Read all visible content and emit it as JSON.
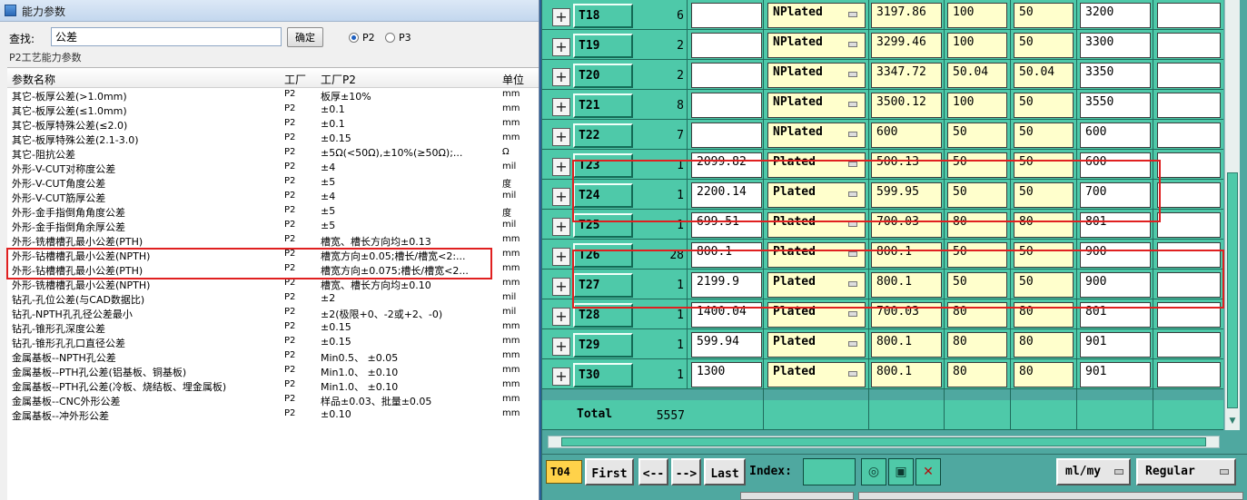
{
  "left_window": {
    "title": "能力参数",
    "search": {
      "label": "查找:",
      "value": "公差"
    },
    "confirm_label": "确定",
    "radios": [
      {
        "label": "P2",
        "checked": true
      },
      {
        "label": "P3",
        "checked": false
      }
    ],
    "group_label": "P2工艺能力参数",
    "columns": [
      "参数名称",
      "工厂",
      "工厂P2",
      "单位"
    ],
    "rows": [
      [
        "其它-板厚公差(>1.0mm)",
        "P2",
        "板厚±10%",
        "mm"
      ],
      [
        "其它-板厚公差(≤1.0mm)",
        "P2",
        "±0.1",
        "mm"
      ],
      [
        "其它-板厚特殊公差(≤2.0)",
        "P2",
        "±0.1",
        "mm"
      ],
      [
        "其它-板厚特殊公差(2.1-3.0)",
        "P2",
        "±0.15",
        "mm"
      ],
      [
        "其它-阻抗公差",
        "P2",
        "±5Ω(<50Ω),±10%(≥50Ω);...",
        "Ω"
      ],
      [
        "外形-V-CUT对称度公差",
        "P2",
        "±4",
        "mil"
      ],
      [
        "外形-V-CUT角度公差",
        "P2",
        "±5",
        "度"
      ],
      [
        "外形-V-CUT筋厚公差",
        "P2",
        "±4",
        "mil"
      ],
      [
        "外形-金手指倒角角度公差",
        "P2",
        "±5",
        "度"
      ],
      [
        "外形-金手指倒角余厚公差",
        "P2",
        "±5",
        "mil"
      ],
      [
        "外形-铣槽槽孔最小公差(PTH)",
        "P2",
        "槽宽、槽长方向均±0.13",
        "mm"
      ],
      [
        "外形-钻槽槽孔最小公差(NPTH)",
        "P2",
        "槽宽方向±0.05;槽长/槽宽<2:...",
        "mm"
      ],
      [
        "外形-钻槽槽孔最小公差(PTH)",
        "P2",
        "槽宽方向±0.075;槽长/槽宽<2...",
        "mm"
      ],
      [
        "外形-铣槽槽孔最小公差(NPTH)",
        "P2",
        "槽宽、槽长方向均±0.10",
        "mm"
      ],
      [
        "钻孔-孔位公差(与CAD数据比)",
        "P2",
        "±2",
        "mil"
      ],
      [
        "钻孔-NPTH孔孔径公差最小",
        "P2",
        "±2(极限+0、-2或+2、-0)",
        "mil"
      ],
      [
        "钻孔-锥形孔深度公差",
        "P2",
        "±0.15",
        "mm"
      ],
      [
        "钻孔-锥形孔孔口直径公差",
        "P2",
        "±0.15",
        "mm"
      ],
      [
        "金属基板--NPTH孔公差",
        "P2",
        "Min0.5、 ±0.05",
        "mm"
      ],
      [
        "金属基板--PTH孔公差(铝基板、铜基板)",
        "P2",
        "Min1.0、 ±0.10",
        "mm"
      ],
      [
        "金属基板--PTH孔公差(冷板、烧结板、埋金属板)",
        "P2",
        "Min1.0、 ±0.10",
        "mm"
      ],
      [
        "金属基板--CNC外形公差",
        "P2",
        "样品±0.03、批量±0.05",
        "mm"
      ],
      [
        "金属基板--冲外形公差",
        "P2",
        "±0.10",
        "mm"
      ]
    ]
  },
  "right_window": {
    "rows": [
      {
        "tool": "T18",
        "qty": "6",
        "c1": "",
        "type": "NPlated",
        "c3": "3197.86",
        "c4": "100",
        "c5": "50",
        "c6": "3200"
      },
      {
        "tool": "T19",
        "qty": "2",
        "c1": "",
        "type": "NPlated",
        "c3": "3299.46",
        "c4": "100",
        "c5": "50",
        "c6": "3300"
      },
      {
        "tool": "T20",
        "qty": "2",
        "c1": "",
        "type": "NPlated",
        "c3": "3347.72",
        "c4": "50.04",
        "c5": "50.04",
        "c6": "3350"
      },
      {
        "tool": "T21",
        "qty": "8",
        "c1": "",
        "type": "NPlated",
        "c3": "3500.12",
        "c4": "100",
        "c5": "50",
        "c6": "3550"
      },
      {
        "tool": "T22",
        "qty": "7",
        "c1": "",
        "type": "NPlated",
        "c3": "600",
        "c4": "50",
        "c5": "50",
        "c6": "600"
      },
      {
        "tool": "T23",
        "qty": "1",
        "c1": "2099.82",
        "type": "Plated",
        "c3": "500.13",
        "c4": "50",
        "c5": "50",
        "c6": "600"
      },
      {
        "tool": "T24",
        "qty": "1",
        "c1": "2200.14",
        "type": "Plated",
        "c3": "599.95",
        "c4": "50",
        "c5": "50",
        "c6": "700"
      },
      {
        "tool": "T25",
        "qty": "1",
        "c1": "699.51",
        "type": "Plated",
        "c3": "700.03",
        "c4": "80",
        "c5": "80",
        "c6": "801"
      },
      {
        "tool": "T26",
        "qty": "28",
        "c1": "800.1",
        "type": "Plated",
        "c3": "800.1",
        "c4": "50",
        "c5": "50",
        "c6": "900"
      },
      {
        "tool": "T27",
        "qty": "1",
        "c1": "2199.9",
        "type": "Plated",
        "c3": "800.1",
        "c4": "50",
        "c5": "50",
        "c6": "900"
      },
      {
        "tool": "T28",
        "qty": "1",
        "c1": "1400.04",
        "type": "Plated",
        "c3": "700.03",
        "c4": "80",
        "c5": "80",
        "c6": "801"
      },
      {
        "tool": "T29",
        "qty": "1",
        "c1": "599.94",
        "type": "Plated",
        "c3": "800.1",
        "c4": "80",
        "c5": "80",
        "c6": "901"
      },
      {
        "tool": "T30",
        "qty": "1",
        "c1": "1300",
        "type": "Plated",
        "c3": "800.1",
        "c4": "80",
        "c5": "80",
        "c6": "901"
      }
    ],
    "total": {
      "label": "Total",
      "value": "5557"
    },
    "nav": {
      "tag": "T04",
      "first": "First",
      "prev": "<--",
      "next": "-->",
      "last": "Last",
      "index_label": "Index:",
      "unit": "ml/my",
      "mode": "Regular"
    }
  },
  "colors": {
    "teal": "#4ec9a9",
    "cream": "#ffffcc",
    "highlight": "#e02020"
  }
}
